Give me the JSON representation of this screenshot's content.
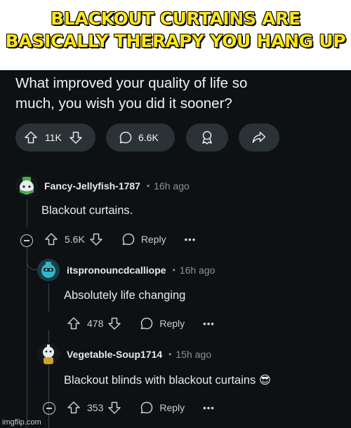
{
  "meme": {
    "caption_line1": "BLACKOUT CURTAINS ARE",
    "caption_line2": "BASICALLY THERAPY YOU HANG UP",
    "caption_color": "#ffe61a"
  },
  "post": {
    "title_line1": "What improved your quality of life so",
    "title_line2": "much, you wish you did it sooner?",
    "score": "11K",
    "comments": "6.6K",
    "icons": [
      "upvote-icon",
      "downvote-icon",
      "comment-icon",
      "award-icon",
      "share-icon"
    ]
  },
  "comments": [
    {
      "author": "Fancy-Jellyfish-1787",
      "time": "16h ago",
      "body": "Blackout curtains.",
      "score": "5.6K",
      "reply_label": "Reply",
      "more_label": "•••"
    },
    {
      "author": "itspronouncdcalliope",
      "time": "16h ago",
      "body": "Absolutely life changing",
      "score": "478",
      "reply_label": "Reply",
      "more_label": "•••"
    },
    {
      "author": "Vegetable-Soup1714",
      "time": "15h ago",
      "body": "Blackout blinds with blackout curtains 😎",
      "score": "353",
      "reply_label": "Reply",
      "more_label": "•••"
    }
  ],
  "watermark": "imgflip.com",
  "colors": {
    "background": "#0e1113",
    "pill": "#2a3236",
    "text": "#e8e8e8",
    "muted": "#8a9296"
  }
}
